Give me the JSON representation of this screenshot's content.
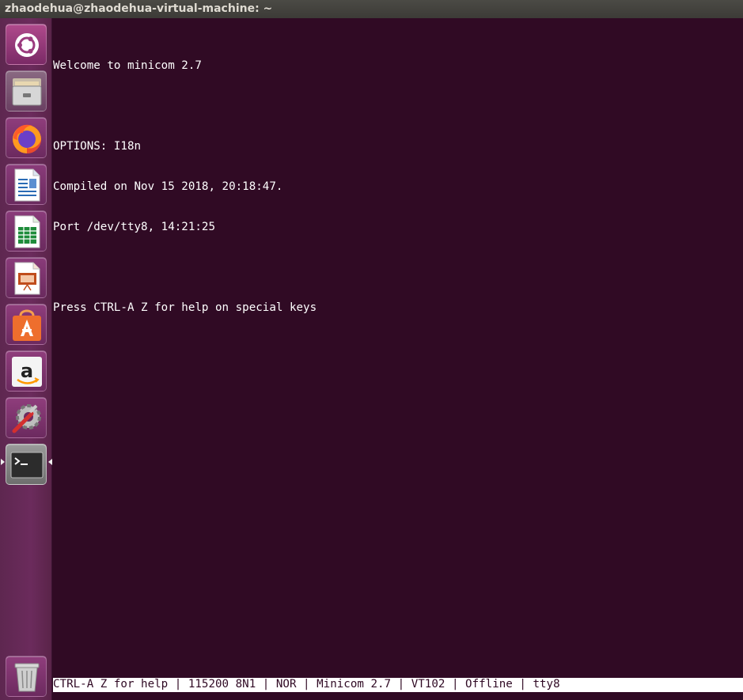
{
  "window": {
    "title": "zhaodehua@zhaodehua-virtual-machine: ~"
  },
  "launcher": {
    "items": [
      {
        "name": "ubuntu-dash-icon",
        "color": "#e95420"
      },
      {
        "name": "files-icon",
        "color": "#8c8c8c"
      },
      {
        "name": "firefox-icon",
        "color": "#ff7139"
      },
      {
        "name": "libreoffice-writer-icon",
        "color": "#2a6bb5"
      },
      {
        "name": "libreoffice-calc-icon",
        "color": "#1e8c3a"
      },
      {
        "name": "libreoffice-impress-icon",
        "color": "#c04d1c"
      },
      {
        "name": "ubuntu-software-icon",
        "color": "#ee6e2d"
      },
      {
        "name": "amazon-icon",
        "color": "#ff9900"
      },
      {
        "name": "system-settings-icon",
        "color": "#9a9a9a"
      },
      {
        "name": "terminal-icon",
        "color": "#2c2c2c",
        "active": true
      },
      {
        "name": "trash-icon",
        "color": "#888888"
      }
    ]
  },
  "terminal": {
    "lines": [
      "Welcome to minicom 2.7",
      "",
      "OPTIONS: I18n",
      "Compiled on Nov 15 2018, 20:18:47.",
      "Port /dev/tty8, 14:21:25",
      "",
      "Press CTRL-A Z for help on special keys"
    ],
    "status_bar": "CTRL-A Z for help | 115200 8N1 | NOR | Minicom 2.7 | VT102 | Offline | tty8"
  },
  "colors": {
    "terminal_bg": "#300a24",
    "terminal_fg": "#ffffff",
    "launcher_bg": "#5e2750"
  }
}
